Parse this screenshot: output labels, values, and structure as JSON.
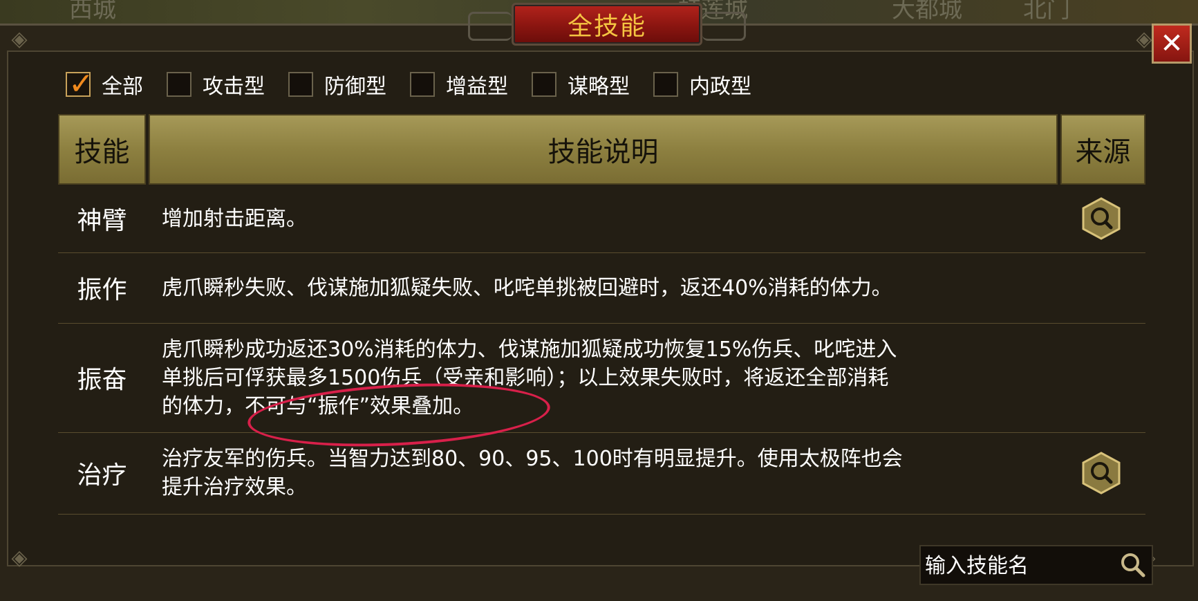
{
  "background_labels": [
    "西城",
    "虹莲城",
    "大都城",
    "北门"
  ],
  "dialog": {
    "title": "全技能",
    "close_label": "✕"
  },
  "filters": [
    {
      "label": "全部",
      "checked": true
    },
    {
      "label": "攻击型",
      "checked": false
    },
    {
      "label": "防御型",
      "checked": false
    },
    {
      "label": "增益型",
      "checked": false
    },
    {
      "label": "谋略型",
      "checked": false
    },
    {
      "label": "内政型",
      "checked": false
    }
  ],
  "table": {
    "headers": {
      "skill": "技能",
      "description": "技能说明",
      "source": "来源"
    },
    "rows": [
      {
        "skill": "神臂",
        "lines": [
          "增加射击距离。"
        ],
        "has_source": true
      },
      {
        "skill": "振作",
        "lines": [
          "虎爪瞬秒失败、伐谋施加狐疑失败、叱咤单挑被回避时，返还40%消耗的体力。"
        ],
        "has_source": false
      },
      {
        "skill": "振奋",
        "lines": [
          "虎爪瞬秒成功返还30%消耗的体力、伐谋施加狐疑成功恢复15%伤兵、叱咤进入",
          "单挑后可俘获最多1500伤兵（受亲和影响）；以上效果失败时，将返还全部消耗",
          "的体力，不可与“振作”效果叠加。"
        ],
        "has_source": false
      },
      {
        "skill": "治疗",
        "lines": [
          "治疗友军的伤兵。当智力达到80、90、95、100时有明显提升。使用太极阵也会",
          "提升治疗效果。"
        ],
        "has_source": true
      }
    ]
  },
  "search": {
    "placeholder": "输入技能名",
    "value": ""
  },
  "colors": {
    "title_text": "#f5c542",
    "title_plate": "#9a1a14",
    "header_bg": "#8d8040",
    "check_mark": "#f08a1e",
    "annotation": "#d8204a"
  }
}
